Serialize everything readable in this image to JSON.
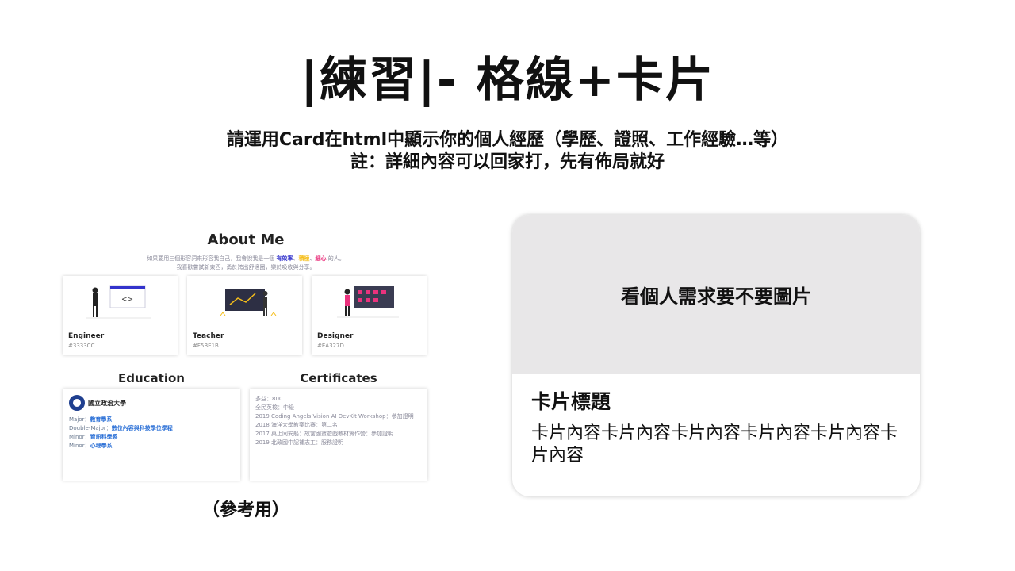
{
  "page": {
    "title": "|練習|- 格線+卡片",
    "subtitle_line1": "請運用Card在html中顯示你的個人經歷（學歷、證照、工作經驗…等）",
    "subtitle_line2": "註：詳細內容可以回家打，先有佈局就好"
  },
  "reference": {
    "about_heading": "About Me",
    "intro_prefix": "如果要用三個形容詞來形容我自己，我會說我是一個",
    "intro_word1": "有效率",
    "intro_sep1": "、",
    "intro_word2": "積極",
    "intro_sep2": "、",
    "intro_word3": "細心",
    "intro_suffix": "的人。",
    "intro_line2": "我喜歡嘗試新東西，勇於跨出舒適圈，樂於吸收與分享。",
    "colors": {
      "word1": "#3333CC",
      "word2": "#F5BE1B",
      "word3": "#EA327D"
    },
    "roles": [
      {
        "name": "Engineer",
        "code": "#3333CC"
      },
      {
        "name": "Teacher",
        "code": "#F5BE1B"
      },
      {
        "name": "Designer",
        "code": "#EA327D"
      }
    ],
    "education_heading": "Education",
    "certificates_heading": "Certificates",
    "school_name": "國立政治大學",
    "education": [
      {
        "label": "Major：",
        "value": "教育學系"
      },
      {
        "label": "Double-Major：",
        "value": "數位內容與科技學位學程"
      },
      {
        "label": "Minor：",
        "value": "資訊科學系"
      },
      {
        "label": "Minor：",
        "value": "心理學系"
      }
    ],
    "certificates": [
      "多益：800",
      "全民英檢：中級",
      "2019 Coding Angels Vision AI DevKit Workshop：參加證明",
      "2018 海洋大學教案比賽：第二名",
      "2017 桌上同安船：故宮國寶遊戲教材實作營：參加證明",
      "2019 北政國中詔補志工：服務證明"
    ],
    "note": "（參考用）"
  },
  "demo_card": {
    "image_text": "看個人需求要不要圖片",
    "title": "卡片標題",
    "text": "卡片內容卡片內容卡片內容卡片內容卡片內容卡片內容"
  }
}
